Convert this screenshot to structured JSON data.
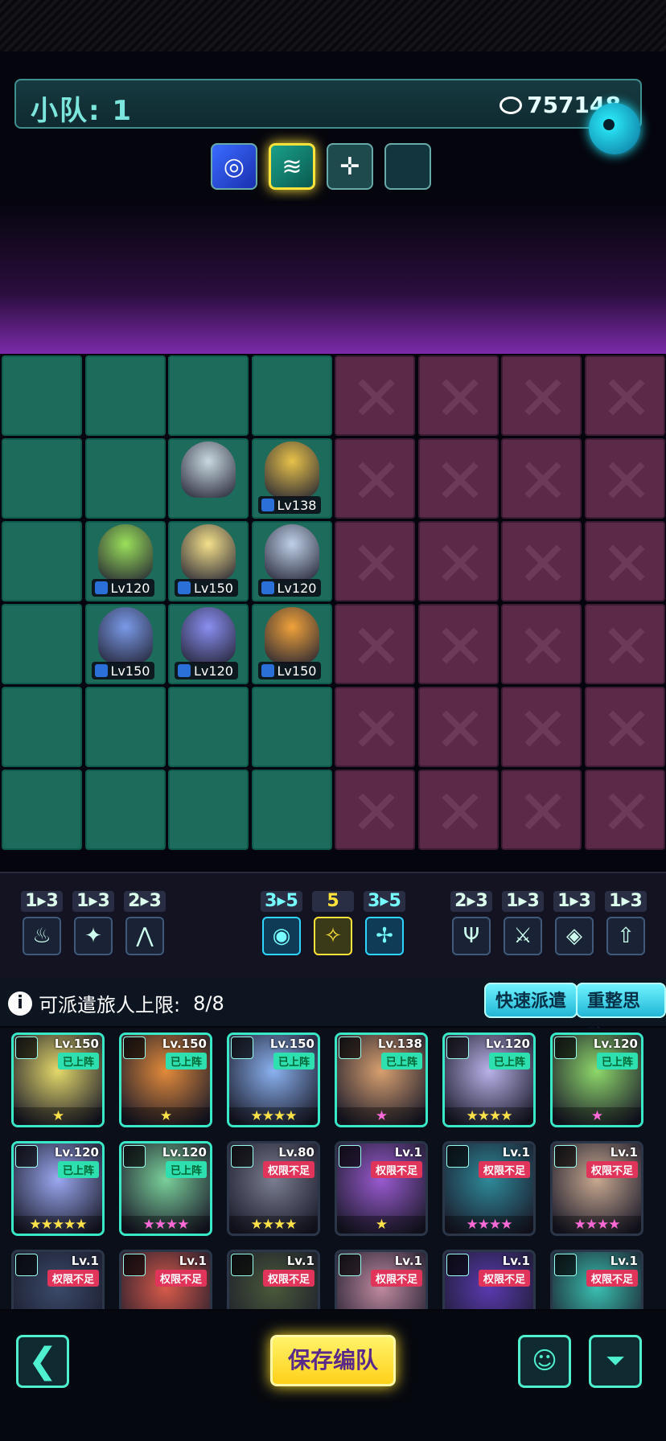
{
  "team": {
    "label": "小队: 1",
    "power": "757148"
  },
  "formation_slots": [
    {
      "icon": "galaxy-swirl-icon",
      "glyph": "◎",
      "selected": false
    },
    {
      "icon": "wave-hourglass-icon",
      "glyph": "≋",
      "selected": true
    },
    {
      "icon": "crosshair-shield-icon",
      "glyph": "✛",
      "selected": false
    },
    {
      "icon": "empty-slot",
      "glyph": "",
      "selected": false
    }
  ],
  "units": [
    {
      "level": "Lv138",
      "color": "#e8c24a"
    },
    {
      "level": "Lv120",
      "color": "#9ae05a"
    },
    {
      "level": "Lv150",
      "color": "#f4e08a"
    },
    {
      "level": "Lv120",
      "color": "#bfd0e8"
    },
    {
      "level": "Lv150",
      "color": "#7a9ae8"
    },
    {
      "level": "Lv120",
      "color": "#8a8ef0"
    },
    {
      "level": "Lv150",
      "color": "#f0a23a"
    },
    {
      "level": "",
      "color": "#c8d8e0"
    }
  ],
  "synergies": [
    {
      "count": "1▸3",
      "icon": "flame-drop-icon",
      "glyph": "♨"
    },
    {
      "count": "1▸3",
      "icon": "shuriken-icon",
      "glyph": "✦"
    },
    {
      "count": "2▸3",
      "icon": "mountain-peak-icon",
      "glyph": "⋀"
    },
    {
      "count": "3▸5",
      "icon": "spiral-icon",
      "glyph": "◉"
    },
    {
      "count": "5",
      "icon": "sparkle-star-icon",
      "glyph": "✧"
    },
    {
      "count": "3▸5",
      "icon": "crossed-target-icon",
      "glyph": "✢"
    },
    {
      "count": "2▸3",
      "icon": "crest-shield-icon",
      "glyph": "Ψ"
    },
    {
      "count": "1▸3",
      "icon": "crossed-swords-icon",
      "glyph": "⚔"
    },
    {
      "count": "1▸3",
      "icon": "diamond-layers-icon",
      "glyph": "◈"
    },
    {
      "count": "1▸3",
      "icon": "arrow-up-icon",
      "glyph": "⇧"
    }
  ],
  "limit": {
    "label": "可派遣旅人上限:",
    "count": "8/8"
  },
  "buttons": {
    "quick_dispatch": "快速派遣",
    "reorganize": "重整思路",
    "save": "保存编队"
  },
  "roster": [
    {
      "level": "Lv.150",
      "status": "已上阵",
      "stars": "★",
      "star_color": "gold",
      "bg": "#e4d86a"
    },
    {
      "level": "Lv.150",
      "status": "已上阵",
      "stars": "★",
      "star_color": "gold",
      "bg": "#e28a3a"
    },
    {
      "level": "Lv.150",
      "status": "已上阵",
      "stars": "★★★★",
      "star_color": "gold",
      "bg": "#8ab2f0"
    },
    {
      "level": "Lv.138",
      "status": "已上阵",
      "stars": "★",
      "star_color": "pink",
      "bg": "#d8a070"
    },
    {
      "level": "Lv.120",
      "status": "已上阵",
      "stars": "★★★★",
      "star_color": "gold",
      "bg": "#b8b2e8"
    },
    {
      "level": "Lv.120",
      "status": "已上阵",
      "stars": "★",
      "star_color": "pink",
      "bg": "#8ed86a"
    },
    {
      "level": "Lv.120",
      "status": "已上阵",
      "stars": "★★★★★",
      "star_color": "gold",
      "bg": "#9aa8f0"
    },
    {
      "level": "Lv.120",
      "status": "已上阵",
      "stars": "★★★★",
      "star_color": "pink",
      "bg": "#7ad09a"
    },
    {
      "level": "Lv.80",
      "status": "权限不足",
      "stars": "★★★★",
      "star_color": "gold",
      "bg": "#7a7e90"
    },
    {
      "level": "Lv.1",
      "status": "权限不足",
      "stars": "★",
      "star_color": "gold",
      "bg": "#9a5ad0"
    },
    {
      "level": "Lv.1",
      "status": "权限不足",
      "stars": "★★★★",
      "star_color": "pink",
      "bg": "#2e8a9a"
    },
    {
      "level": "Lv.1",
      "status": "权限不足",
      "stars": "★★★★",
      "star_color": "pink",
      "bg": "#c8a890"
    },
    {
      "level": "Lv.1",
      "status": "权限不足",
      "stars": "",
      "star_color": "gold",
      "bg": "#3a4a6a"
    },
    {
      "level": "Lv.1",
      "status": "权限不足",
      "stars": "",
      "star_color": "gold",
      "bg": "#d85a4a"
    },
    {
      "level": "Lv.1",
      "status": "权限不足",
      "stars": "",
      "star_color": "gold",
      "bg": "#4a5a3a"
    },
    {
      "level": "Lv.1",
      "status": "权限不足",
      "stars": "",
      "star_color": "gold",
      "bg": "#c08aa0"
    },
    {
      "level": "Lv.1",
      "status": "权限不足",
      "stars": "",
      "star_color": "gold",
      "bg": "#5a3ab0"
    },
    {
      "level": "Lv.1",
      "status": "权限不足",
      "stars": "",
      "star_color": "gold",
      "bg": "#3ac0b0"
    }
  ],
  "bottom": {
    "back_icon": "back-arrow-icon",
    "back_glyph": "❮",
    "brain_icon": "brain-plus-icon",
    "brain_glyph": "☺",
    "filter_icon": "filter-funnel-icon",
    "filter_glyph": "⏷"
  }
}
